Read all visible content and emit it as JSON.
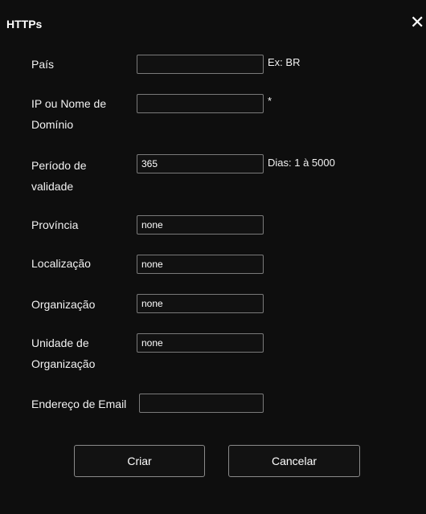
{
  "dialog": {
    "title": "HTTPs",
    "close_symbol": "✕"
  },
  "form": {
    "pais": {
      "label": "País",
      "value": "",
      "hint": "Ex: BR"
    },
    "ip": {
      "label_line1": "IP ou Nome de",
      "label_line2": "Domínio",
      "value": "",
      "hint": "*"
    },
    "periodo": {
      "label_line1": "Período de",
      "label_line2": "validade",
      "value": "365",
      "hint": "Dias: 1 à 5000"
    },
    "provincia": {
      "label": "Província",
      "value": "none"
    },
    "localizacao": {
      "label": "Localização",
      "value": "none"
    },
    "organizacao": {
      "label": "Organização",
      "value": "none"
    },
    "unidade": {
      "label_line1": "Unidade de",
      "label_line2": "Organização",
      "value": "none"
    },
    "email": {
      "label": "Endereço de Email",
      "value": ""
    }
  },
  "buttons": {
    "create": "Criar",
    "cancel": "Cancelar"
  },
  "colors": {
    "background": "#0e0e0e",
    "border": "#7a7a7a",
    "text": "#ffffff"
  }
}
